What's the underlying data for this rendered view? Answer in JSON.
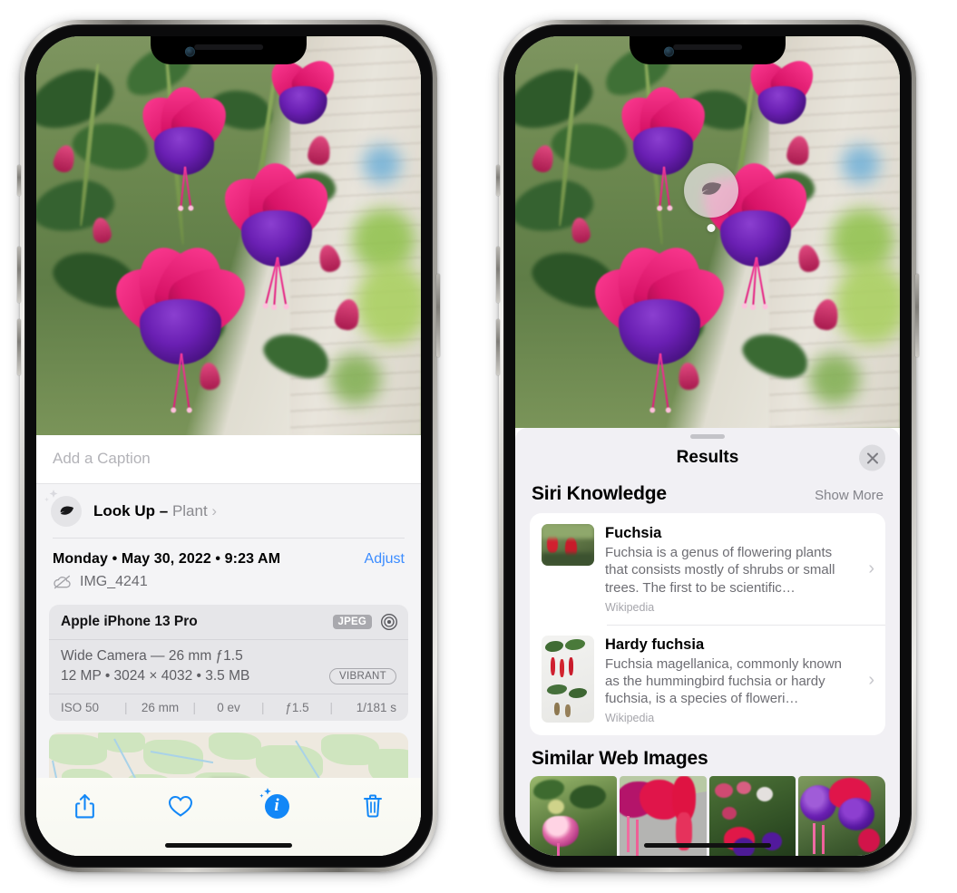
{
  "left_phone": {
    "name": "iphone-photos-info",
    "caption": {
      "placeholder": "Add a Caption",
      "value": ""
    },
    "lookup": {
      "icon": "leaf-icon",
      "sparkle_icon": "sparkles-icon",
      "label": "Look Up",
      "dash": "–",
      "subject": "Plant",
      "chevron": "›"
    },
    "metadata": {
      "date_line": "Monday • May 30, 2022 • 9:23 AM",
      "adjust_label": "Adjust",
      "cloud_icon": "cloud-slash-icon",
      "filename": "IMG_4241"
    },
    "exif": {
      "device": "Apple iPhone 13 Pro",
      "format_badge": "JPEG",
      "lens_icon": "aperture-icon",
      "lens_line": "Wide Camera — 26 mm ƒ1.5",
      "size_line": "12 MP • 3024 × 4032 • 3.5 MB",
      "style_badge": "VIBRANT",
      "stats": [
        "ISO 50",
        "26 mm",
        "0 ev",
        "ƒ1.5",
        "1/181 s"
      ]
    },
    "map": {
      "name": "location-map-preview",
      "pin": "photo-pin"
    },
    "toolbar": [
      {
        "name": "share-icon",
        "label": "Share"
      },
      {
        "name": "heart-icon",
        "label": "Favorite"
      },
      {
        "name": "info-icon",
        "label": "Info",
        "active": true
      },
      {
        "name": "trash-icon",
        "label": "Delete"
      }
    ]
  },
  "right_phone": {
    "name": "iphone-visual-lookup-results",
    "photo_badge": {
      "icon": "leaf-icon",
      "name": "visual-lookup-badge"
    },
    "sheet": {
      "grabber": "sheet-grabber",
      "title": "Results",
      "close_icon": "close-icon"
    },
    "siri_knowledge": {
      "title": "Siri Knowledge",
      "action": "Show More",
      "items": [
        {
          "title": "Fuchsia",
          "description": "Fuchsia is a genus of flowering plants that consists mostly of shrubs or small trees. The first to be scientific…",
          "source": "Wikipedia",
          "chevron": "›"
        },
        {
          "title": "Hardy fuchsia",
          "description": "Fuchsia magellanica, commonly known as the hummingbird fuchsia or hardy fuchsia, is a species of floweri…",
          "source": "Wikipedia",
          "chevron": "›"
        }
      ]
    },
    "similar_web_images": {
      "title": "Similar Web Images",
      "thumbnails": [
        "fuchsia-pink-white",
        "fuchsia-red-closeup",
        "fuchsia-bush-buds",
        "fuchsia-purple-red"
      ]
    }
  },
  "colors": {
    "accent_blue": "#3b8cff",
    "info_blue": "#1287f7",
    "sheet_bg": "#f1f0f4",
    "card_white": "#ffffff",
    "exif_bg": "#e6e6e9",
    "muted_text": "#8a8a8f"
  }
}
